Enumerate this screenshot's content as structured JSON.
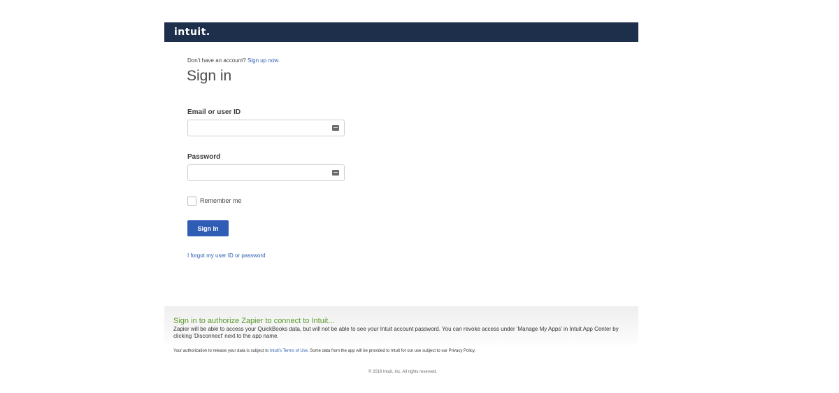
{
  "header": {
    "logo_text": "intuit."
  },
  "signin_form": {
    "no_account_text": "Don't have an account?",
    "signup_link": "Sign up now.",
    "title": "Sign in",
    "email_label": "Email or user ID",
    "email_value": "",
    "password_label": "Password",
    "password_value": "",
    "remember_label": "Remember me",
    "remember_checked": false,
    "submit_label": "Sign In",
    "forgot_link": "I forgot my user ID or password"
  },
  "authorization": {
    "title": "Sign in to authorize Zapier to connect to Intuit...",
    "description": "Zapier will be able to access your QuickBooks data, but will not be able to see your Intuit account password. You can revoke access under 'Manage My Apps' in Intuit App Center by clicking 'Disconnect' next to the app name."
  },
  "terms": {
    "prefix": "Your authorization to release your data is subject to ",
    "link": "Intuit's Terms of Use",
    "suffix": ". Some data from the app will be provided to Intuit for our use subject to our Privacy Policy."
  },
  "footer": {
    "copyright": "© 2016 Intuit, Inc. All rights reserved."
  },
  "icons": {
    "autofill": "autofill-key-icon"
  },
  "colors": {
    "header_bg": "#1d2f4a",
    "primary_button": "#2f5cb5",
    "link": "#2a5db0",
    "auth_title": "#5a9a2c"
  }
}
